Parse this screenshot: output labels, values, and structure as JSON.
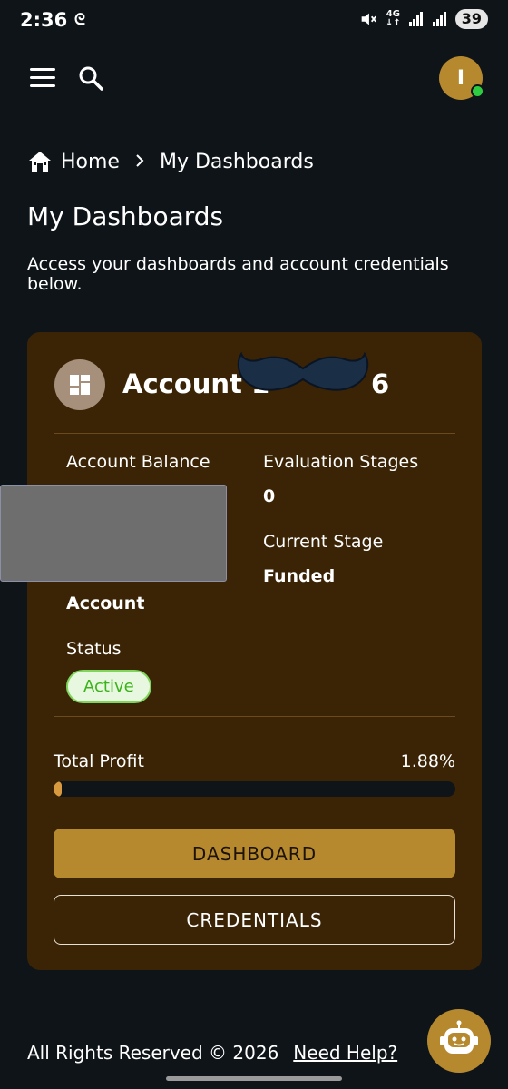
{
  "status_bar": {
    "time": "2:36",
    "network_label_top": "4G",
    "network_label_bottom": "↓↑",
    "battery": "39"
  },
  "breadcrumb": {
    "home": "Home",
    "separator": ">",
    "current": "My Dashboards"
  },
  "header": {
    "avatar_initial": "I"
  },
  "page": {
    "title": "My Dashboards",
    "description": "Access your dashboards and account credentials below."
  },
  "account_card": {
    "title": "Account 1",
    "title_tail": "6",
    "balance_label": "Account Balance",
    "account_type_line": "Account",
    "evaluation_label": "Evaluation Stages",
    "evaluation_value": "0",
    "current_stage_label": "Current Stage",
    "current_stage_value": "Funded",
    "status_label": "Status",
    "status_value": "Active",
    "total_profit_label": "Total Profit",
    "total_profit_value": "1.88%",
    "profit_progress": 0.0188,
    "dashboard_button": "DASHBOARD",
    "credentials_button": "CREDENTIALS"
  },
  "footer": {
    "copyright": "All Rights Reserved © 2026",
    "help_link": "Need Help?"
  },
  "colors": {
    "background": "#0f1419",
    "card": "#3b2406",
    "accent": "#b6892e",
    "status_active": "#3cb31a"
  }
}
